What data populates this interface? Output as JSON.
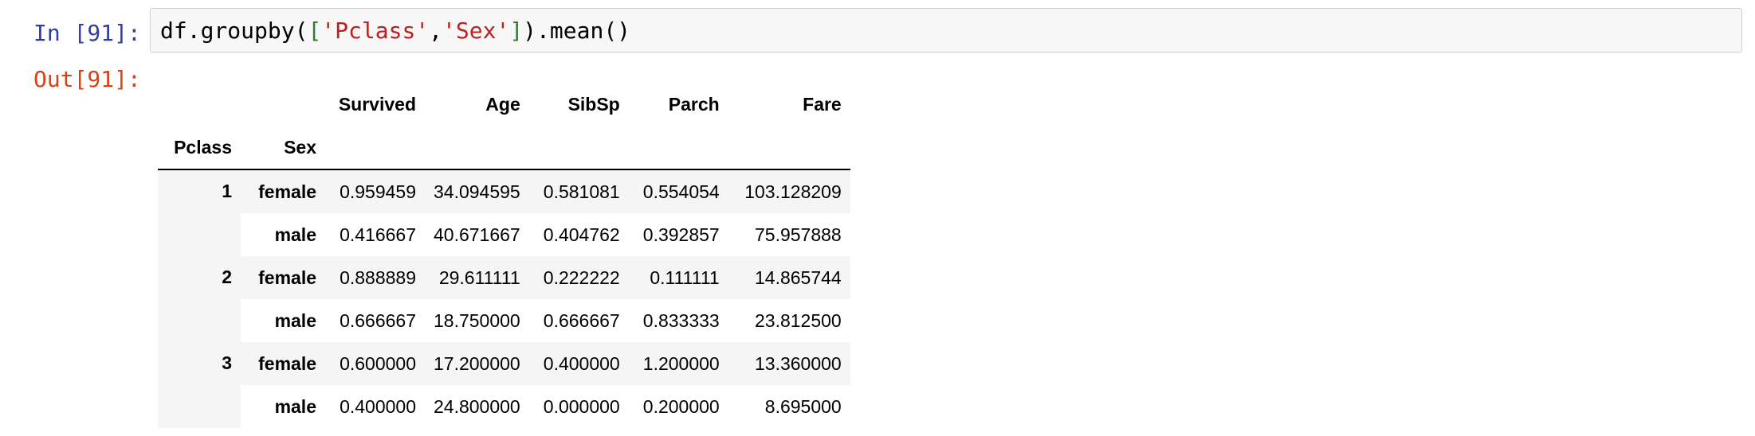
{
  "input_cell": {
    "prompt": "In [91]:",
    "code_tokens": [
      {
        "text": "df.groupby(",
        "kind": "plain"
      },
      {
        "text": "[",
        "kind": "bracket"
      },
      {
        "text": "'Pclass'",
        "kind": "string"
      },
      {
        "text": ",",
        "kind": "plain"
      },
      {
        "text": "'Sex'",
        "kind": "string"
      },
      {
        "text": "]",
        "kind": "bracket"
      },
      {
        "text": ").mean()",
        "kind": "plain"
      }
    ]
  },
  "output_cell": {
    "prompt": "Out[91]:",
    "table": {
      "columns": [
        "Survived",
        "Age",
        "SibSp",
        "Parch",
        "Fare"
      ],
      "index_names": [
        "Pclass",
        "Sex"
      ],
      "rows": [
        {
          "pclass": "1",
          "sex": "female",
          "values": [
            "0.959459",
            "34.094595",
            "0.581081",
            "0.554054",
            "103.128209"
          ]
        },
        {
          "pclass": "",
          "sex": "male",
          "values": [
            "0.416667",
            "40.671667",
            "0.404762",
            "0.392857",
            "75.957888"
          ]
        },
        {
          "pclass": "2",
          "sex": "female",
          "values": [
            "0.888889",
            "29.611111",
            "0.222222",
            "0.111111",
            "14.865744"
          ]
        },
        {
          "pclass": "",
          "sex": "male",
          "values": [
            "0.666667",
            "18.750000",
            "0.666667",
            "0.833333",
            "23.812500"
          ]
        },
        {
          "pclass": "3",
          "sex": "female",
          "values": [
            "0.600000",
            "17.200000",
            "0.400000",
            "1.200000",
            "13.360000"
          ]
        },
        {
          "pclass": "",
          "sex": "male",
          "values": [
            "0.400000",
            "24.800000",
            "0.000000",
            "0.200000",
            "8.695000"
          ]
        }
      ]
    }
  },
  "colors": {
    "in_prompt": "#303f9f",
    "out_prompt": "#d84315",
    "string": "#ba2121",
    "bracket": "#2e7d32",
    "row_stripe": "#f5f5f5"
  }
}
